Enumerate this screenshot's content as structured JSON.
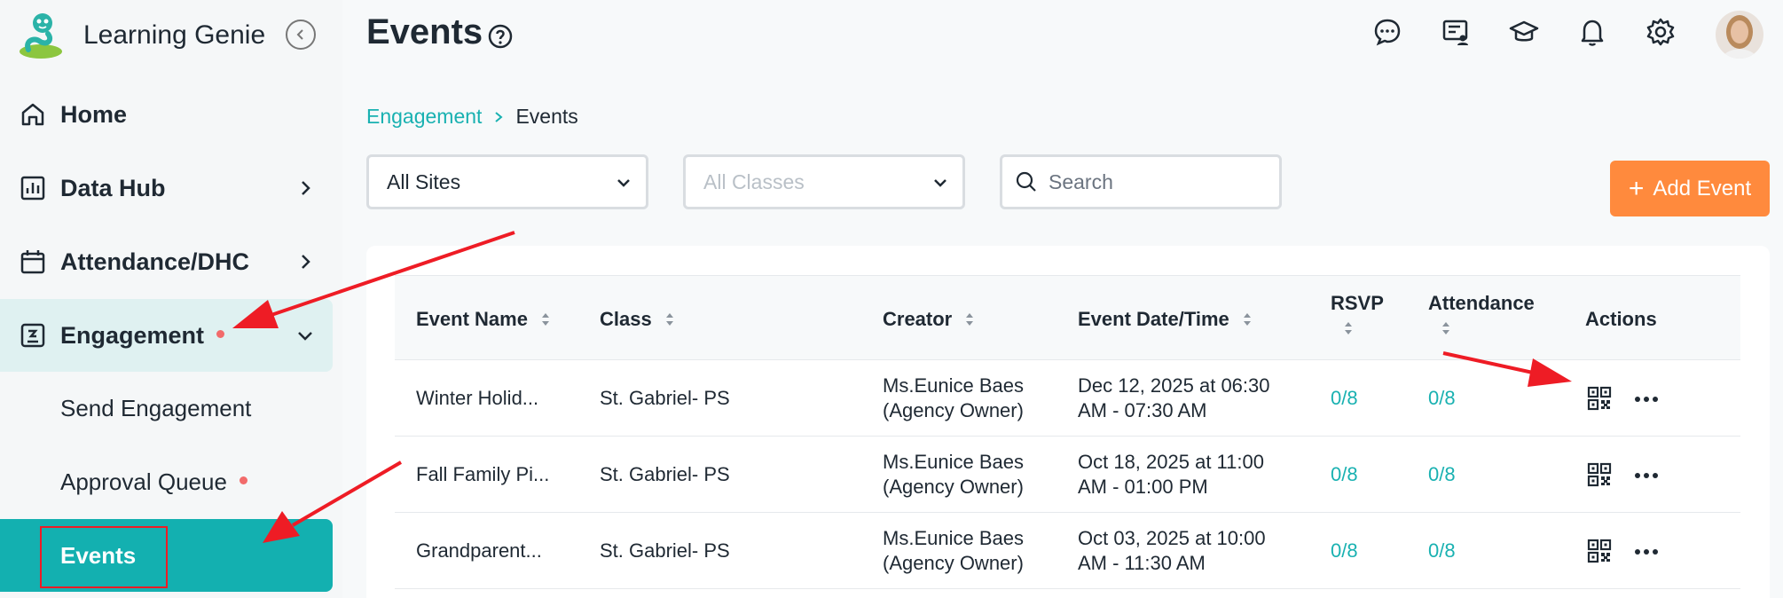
{
  "brand": {
    "name": "Learning Genie"
  },
  "sidebar": {
    "items": [
      {
        "label": "Home",
        "icon": "home-icon"
      },
      {
        "label": "Data Hub",
        "icon": "bar-chart-icon"
      },
      {
        "label": "Attendance/DHC",
        "icon": "calendar-icon"
      },
      {
        "label": "Engagement",
        "icon": "engagement-icon"
      }
    ],
    "sub_items": [
      {
        "label": "Send Engagement"
      },
      {
        "label": "Approval Queue"
      },
      {
        "label": "Events"
      }
    ]
  },
  "header": {
    "title": "Events"
  },
  "breadcrumb": {
    "parent": "Engagement",
    "current": "Events"
  },
  "filters": {
    "site": "All Sites",
    "class": "All Classes",
    "search_placeholder": "Search"
  },
  "add_button": {
    "label": "Add Event"
  },
  "table": {
    "columns": [
      "Event Name",
      "Class",
      "Creator",
      "Event Date/Time",
      "RSVP",
      "Attendance",
      "Actions"
    ],
    "rows": [
      {
        "name": "Winter Holid...",
        "class": "St. Gabriel- PS",
        "creator_1": "Ms.Eunice Baes",
        "creator_2": "(Agency Owner)",
        "date_1": "Dec 12, 2025 at 06:30",
        "date_2": "AM - 07:30 AM",
        "rsvp": "0/8",
        "attendance": "0/8"
      },
      {
        "name": "Fall Family Pi...",
        "class": "St. Gabriel- PS",
        "creator_1": "Ms.Eunice Baes",
        "creator_2": "(Agency Owner)",
        "date_1": "Oct 18, 2025 at 11:00",
        "date_2": "AM - 01:00 PM",
        "rsvp": "0/8",
        "attendance": "0/8"
      },
      {
        "name": "Grandparent...",
        "class": "St. Gabriel- PS",
        "creator_1": "Ms.Eunice Baes",
        "creator_2": "(Agency Owner)",
        "date_1": "Oct 03, 2025 at 10:00",
        "date_2": "AM - 11:30 AM",
        "rsvp": "0/8",
        "attendance": "0/8"
      }
    ]
  },
  "colors": {
    "accent": "#13b0b0",
    "primary_button": "#ff8a3d",
    "annotation": "#ee1c25"
  }
}
